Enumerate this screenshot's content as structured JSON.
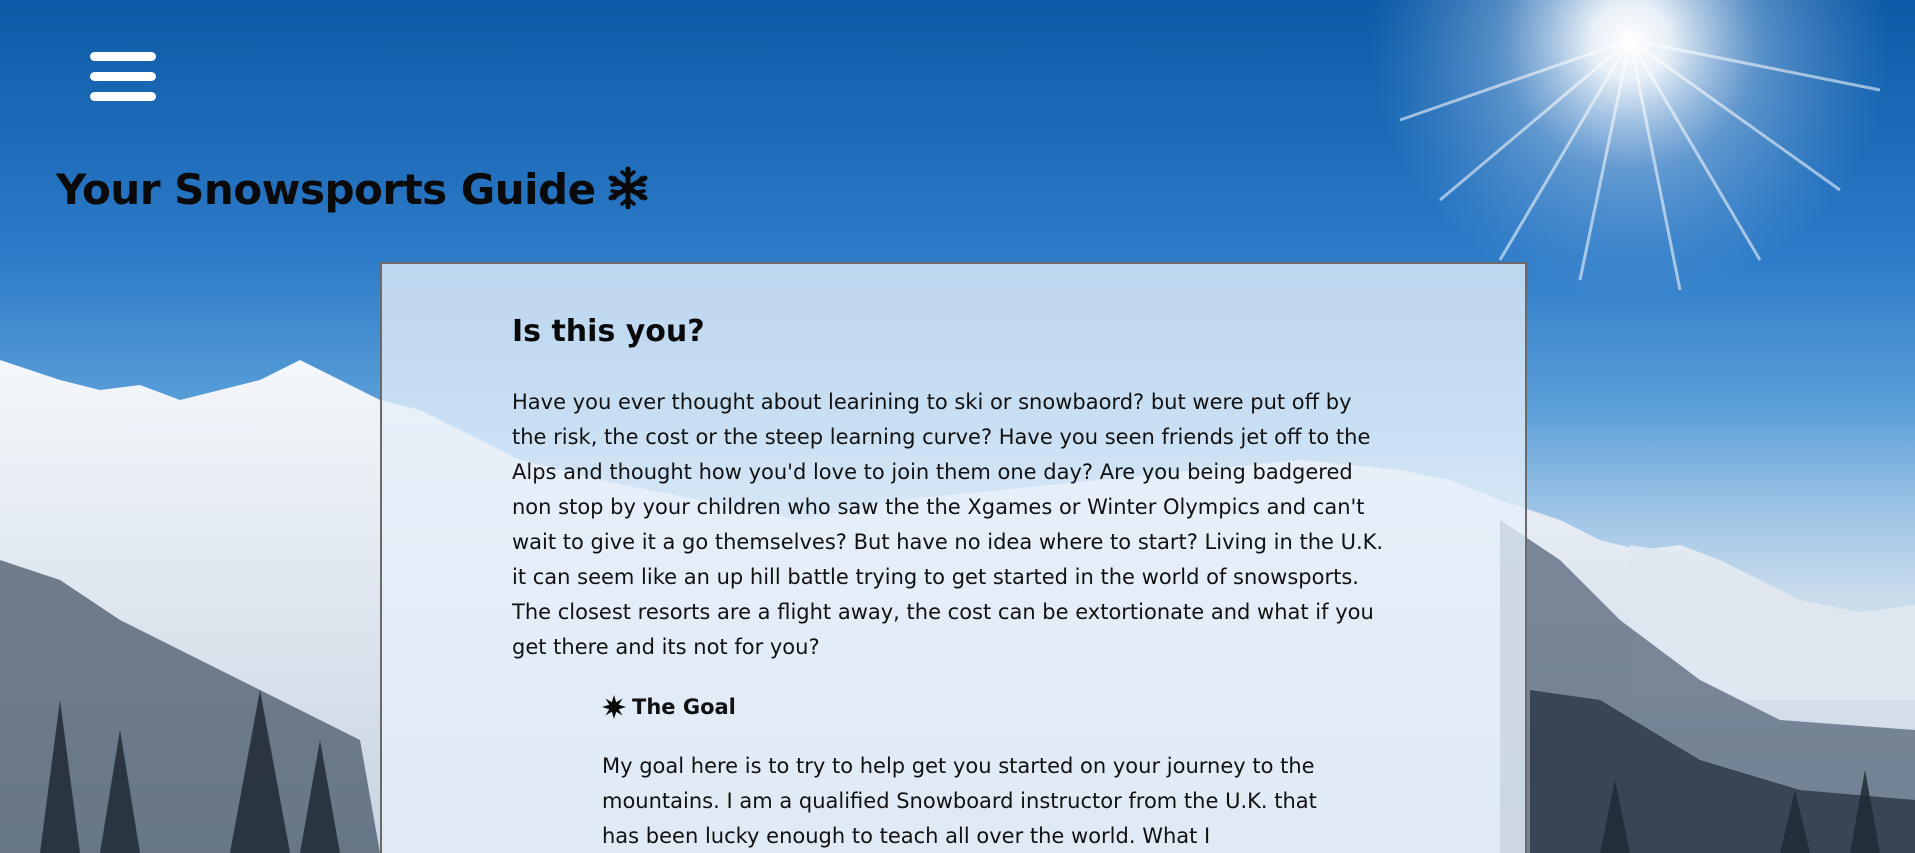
{
  "header": {
    "menu_icon": "hamburger-menu-icon",
    "title": "Your Snowsports Guide",
    "title_icon": "snowflake-icon"
  },
  "card": {
    "heading": "Is this you?",
    "intro": "Have you ever thought about learining to ski or snowbaord? but were put off by the risk, the cost or the steep learning curve? Have you seen friends jet off to the Alps and thought how you'd love to join them one day? Are you being badgered non stop by your children who saw the the Xgames or Winter Olympics and can't wait to give it a go themselves? But have no idea where to start? Living in the U.K. it can seem like an up hill battle trying to get started in the world of snowsports. The closest resorts are a flight away, the cost can be extortionate and what if you get there and its not for you?",
    "goal_heading": "The Goal",
    "goal_icon": "starburst-icon",
    "goal_text": "My goal here is to try to help get you started on your journey to the mountains. I am a qualified Snowboard instructor from the U.K. that has been lucky enough to teach all over the world. What I"
  },
  "colors": {
    "sky_top": "#0d5aa7",
    "card_bg": "rgba(230, 240, 250, 0.78)",
    "card_border": "#6a6a6a",
    "menu_icon": "#ffffff"
  }
}
